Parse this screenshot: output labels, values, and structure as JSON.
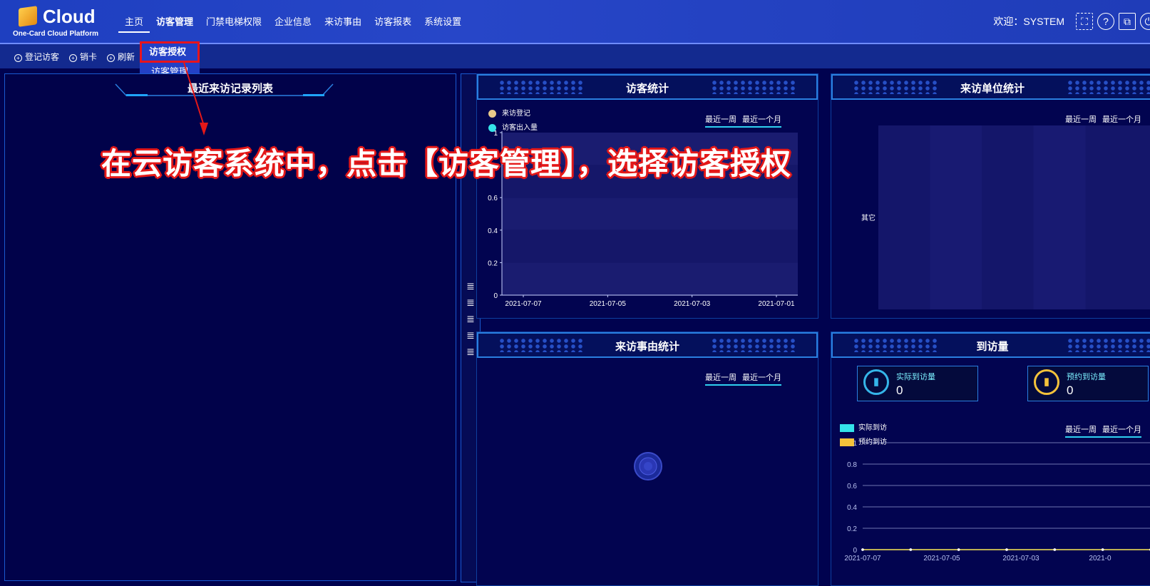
{
  "header": {
    "logo_text": "Cloud",
    "logo_sub": "One-Card Cloud Platform",
    "nav": [
      "主页",
      "访客管理",
      "门禁电梯权限",
      "企业信息",
      "来访事由",
      "访客报表",
      "系统设置"
    ],
    "welcome": "欢迎：SYSTEM"
  },
  "toolbar": {
    "register": "登记访客",
    "cancel_card": "销卡",
    "refresh": "刷新"
  },
  "dropdown": {
    "authorize": "访客授权",
    "manage": "访客管理"
  },
  "left_panel": {
    "title": "最近来访记录列表"
  },
  "annotation": "在云访客系统中，点击【访客管理】，选择访客授权",
  "visitor_stats": {
    "title": "访客统计",
    "legend": [
      "来访登记",
      "访客出入量"
    ],
    "period_week": "最近一周",
    "period_month": "最近一个月"
  },
  "unit_stats": {
    "title": "来访单位统计",
    "period_week": "最近一周",
    "period_month": "最近一个月",
    "category": "其它"
  },
  "reason_stats": {
    "title": "来访事由统计",
    "period_week": "最近一周",
    "period_month": "最近一个月"
  },
  "arrival": {
    "title": "到访量",
    "actual_label": "实际到访量",
    "actual_value": "0",
    "planned_label": "预约到访量",
    "planned_value": "0",
    "legend": [
      "实际到访",
      "预约到访"
    ],
    "period_week": "最近一周",
    "period_month": "最近一个月"
  },
  "chart_data": [
    {
      "type": "line",
      "title": "访客统计",
      "x": [
        "2021-07-07",
        "2021-07-05",
        "2021-07-03",
        "2021-07-01"
      ],
      "yticks": [
        "0",
        "0.2",
        "0.4",
        "0.6",
        "1"
      ],
      "ylim": [
        0,
        1
      ],
      "series": [
        {
          "name": "来访登记",
          "values": [
            0,
            0,
            0,
            0
          ]
        },
        {
          "name": "访客出入量",
          "values": [
            0,
            0,
            0,
            0
          ]
        }
      ],
      "colors": [
        "#e8c98a",
        "#35e3e9"
      ]
    },
    {
      "type": "line",
      "title": "到访量",
      "x": [
        "2021-07-07",
        "2021-07-05",
        "2021-07-03",
        "2021-0"
      ],
      "yticks": [
        "0",
        "0.2",
        "0.4",
        "0.6",
        "0.8",
        "1"
      ],
      "ylim": [
        0,
        1
      ],
      "series": [
        {
          "name": "实际到访",
          "values": [
            0,
            0,
            0,
            0,
            0,
            0,
            0
          ]
        },
        {
          "name": "预约到访",
          "values": [
            0,
            0,
            0,
            0,
            0,
            0,
            0
          ]
        }
      ],
      "colors": [
        "#35e3e9",
        "#f5c33b"
      ]
    }
  ]
}
